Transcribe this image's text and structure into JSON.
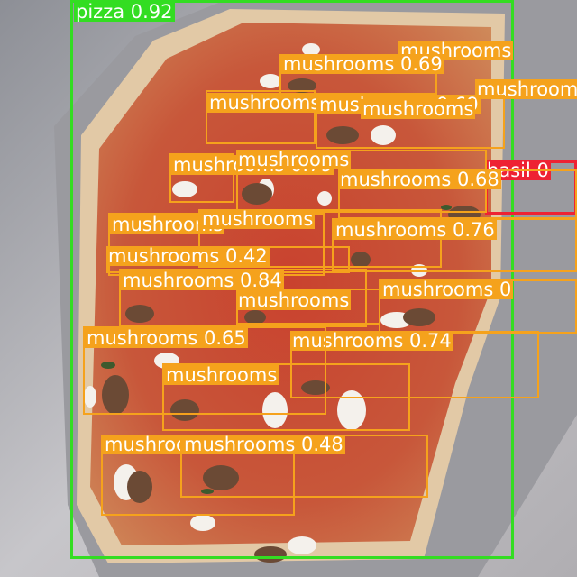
{
  "colors": {
    "pizza": "#33dd22",
    "mushrooms": "#f5a21c",
    "basil": "#ee2233",
    "label_text": "#ffffff"
  },
  "detections": [
    {
      "label": "pizza 0.92",
      "cls": "pizza"
    },
    {
      "label": "mushrooms",
      "cls": "mushrooms"
    },
    {
      "label": "mushrooms 0.69",
      "cls": "mushrooms"
    },
    {
      "label": "mushrooms",
      "cls": "mushrooms"
    },
    {
      "label": "mushrooms",
      "cls": "mushrooms"
    },
    {
      "label": "mushrooms 0.69",
      "cls": "mushrooms"
    },
    {
      "label": "mushrooms",
      "cls": "mushrooms"
    },
    {
      "label": "basil 0",
      "cls": "basil"
    },
    {
      "label": "mushrooms 0.79",
      "cls": "mushrooms"
    },
    {
      "label": "mushrooms",
      "cls": "mushrooms"
    },
    {
      "label": "mushrooms 0.68",
      "cls": "mushrooms"
    },
    {
      "label": "mushrooms",
      "cls": "mushrooms"
    },
    {
      "label": "mushrooms",
      "cls": "mushrooms"
    },
    {
      "label": "mushrooms 0.76",
      "cls": "mushrooms"
    },
    {
      "label": "mushrooms 0.42",
      "cls": "mushrooms"
    },
    {
      "label": "mushrooms 0.84",
      "cls": "mushrooms"
    },
    {
      "label": "mushrooms 0",
      "cls": "mushrooms"
    },
    {
      "label": "mushrooms",
      "cls": "mushrooms"
    },
    {
      "label": "mushrooms 0.74",
      "cls": "mushrooms"
    },
    {
      "label": "mushrooms 0.65",
      "cls": "mushrooms"
    },
    {
      "label": "mushrooms",
      "cls": "mushrooms"
    },
    {
      "label": "mushrooms 0.54",
      "cls": "mushrooms"
    },
    {
      "label": "mushrooms 0.48",
      "cls": "mushrooms"
    }
  ]
}
